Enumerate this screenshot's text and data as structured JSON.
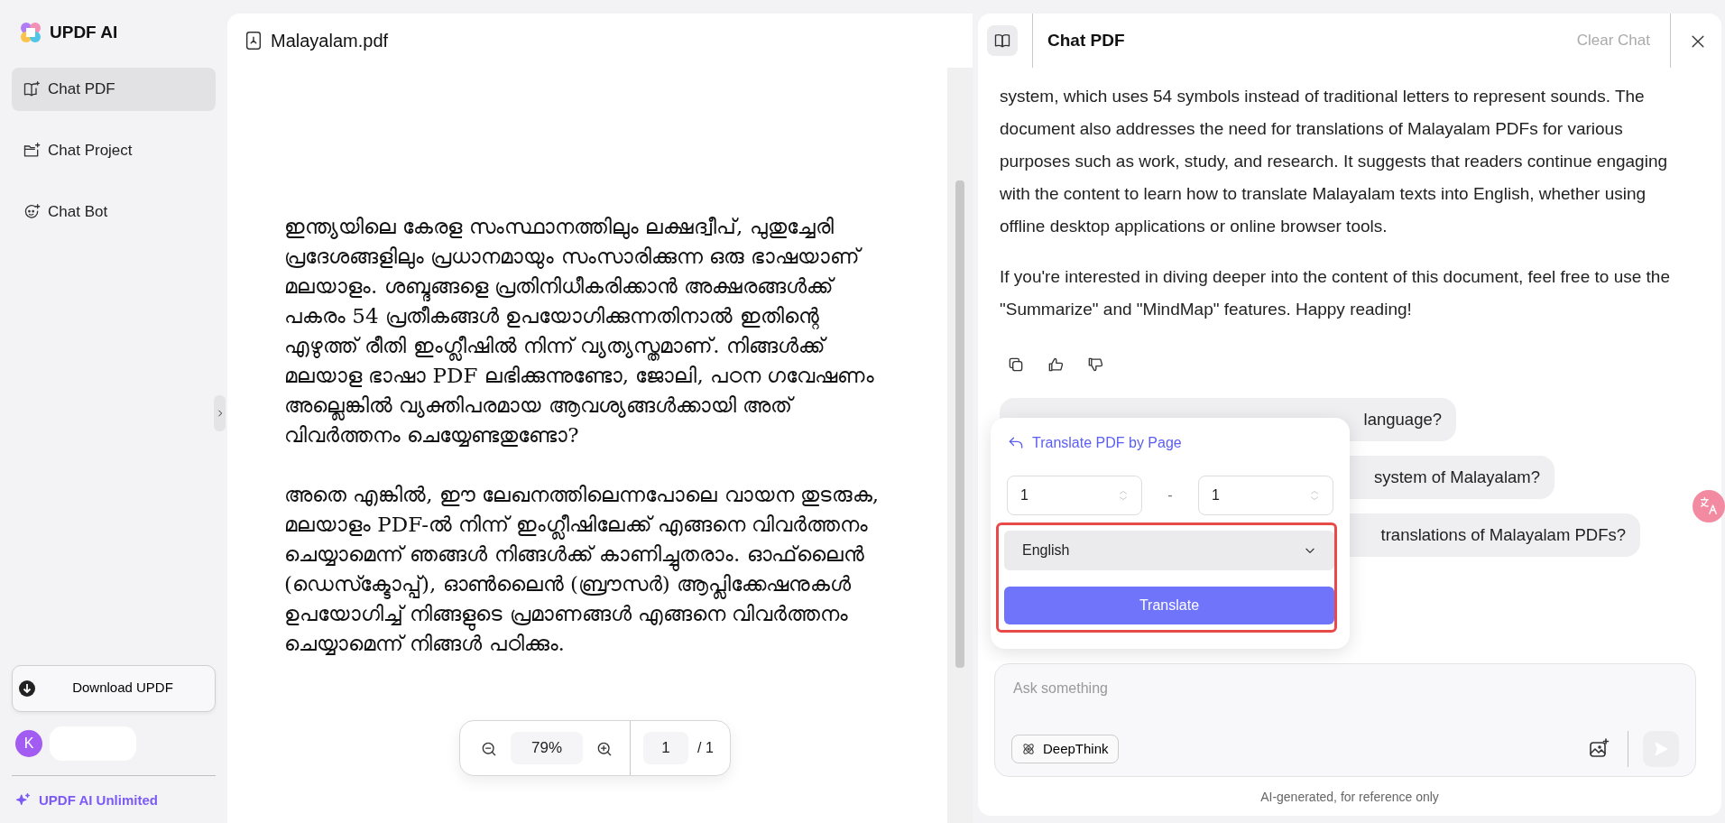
{
  "sidebar": {
    "logo": "UPDF AI",
    "items": [
      {
        "label": "Chat PDF",
        "selected": true
      },
      {
        "label": "Chat Project",
        "selected": false
      },
      {
        "label": "Chat Bot",
        "selected": false
      }
    ],
    "download_button": "Download UPDF",
    "avatar": "K",
    "upgrade": "UPDF AI Unlimited"
  },
  "document": {
    "title": "Malayalam.pdf",
    "paragraphs": [
      "ഇന്ത്യയിലെ കേരള സംസ്ഥാനത്തിലും ലക്ഷദ്വീപ്, പുതുച്ചേരി പ്രദേശങ്ങളിലും പ്രധാനമായും സംസാരിക്കുന്ന ഒരു ഭാഷയാണ് മലയാളം. ശബ്ദങ്ങളെ പ്രതിനിധീകരിക്കാൻ അക്ഷരങ്ങൾക്ക് പകരം 54 പ്രതീകങ്ങൾ ഉപയോഗിക്കുന്നതിനാൽ ഇതിന്റെ എഴുത്ത് രീതി ഇംഗ്ലീഷിൽ നിന്ന് വ്യത്യസ്തമാണ്. നിങ്ങൾക്ക് മലയാള ഭാഷാ PDF ലഭിക്കുന്നുണ്ടോ, ജോലി, പഠന ഗവേഷണം അല്ലെങ്കിൽ വ്യക്തിപരമായ ആവശ്യങ്ങൾക്കായി അത് വിവർത്തനം ചെയ്യേണ്ടതുണ്ടോ?",
      "അതെ എങ്കിൽ, ഈ ലേഖനത്തിലെന്നപോലെ വായന തുടരുക, മലയാളം PDF-ൽ നിന്ന് ഇംഗ്ലീഷിലേക്ക് എങ്ങനെ വിവർത്തനം ചെയ്യാമെന്ന് ഞങ്ങൾ നിങ്ങൾക്ക് കാണിച്ചുതരാം. ഓഫ്‌ലൈൻ (ഡെസ്ക്ടോപ്പ്), ഓൺലൈൻ (ബ്രൗസർ) ആപ്ലിക്കേഷനുകൾ ഉപയോഗിച്ച് നിങ്ങളുടെ പ്രമാണങ്ങൾ എങ്ങനെ വിവർത്തനം ചെയ്യാമെന്ന് നിങ്ങൾ പഠിക്കും."
    ],
    "zoom": "79%",
    "page": "1",
    "pages": "/ 1"
  },
  "chat": {
    "title": "Chat PDF",
    "clear": "Clear Chat",
    "answer": [
      "system, which uses 54 symbols instead of traditional letters to represent sounds. The document also addresses the need for translations of Malayalam PDFs for various purposes such as work, study, and research. It suggests that readers continue engaging with the content to learn how to translate Malayalam texts into English, whether using offline desktop applications or online browser tools.",
      "If you're interested in diving deeper into the content of this document, feel free to use the \"Summarize\" and \"MindMap\" features. Happy reading!"
    ],
    "questions": [
      "language?",
      "system of Malayalam?",
      "translations of Malayalam PDFs?"
    ],
    "popup": {
      "title": "Translate PDF by Page",
      "from": "1",
      "separator": "-",
      "to": "1",
      "language": "English",
      "button": "Translate",
      "highlighted": true
    },
    "input": {
      "placeholder": "Ask something"
    },
    "deepthink": "DeepThink",
    "footer": "AI-generated, for reference only"
  }
}
